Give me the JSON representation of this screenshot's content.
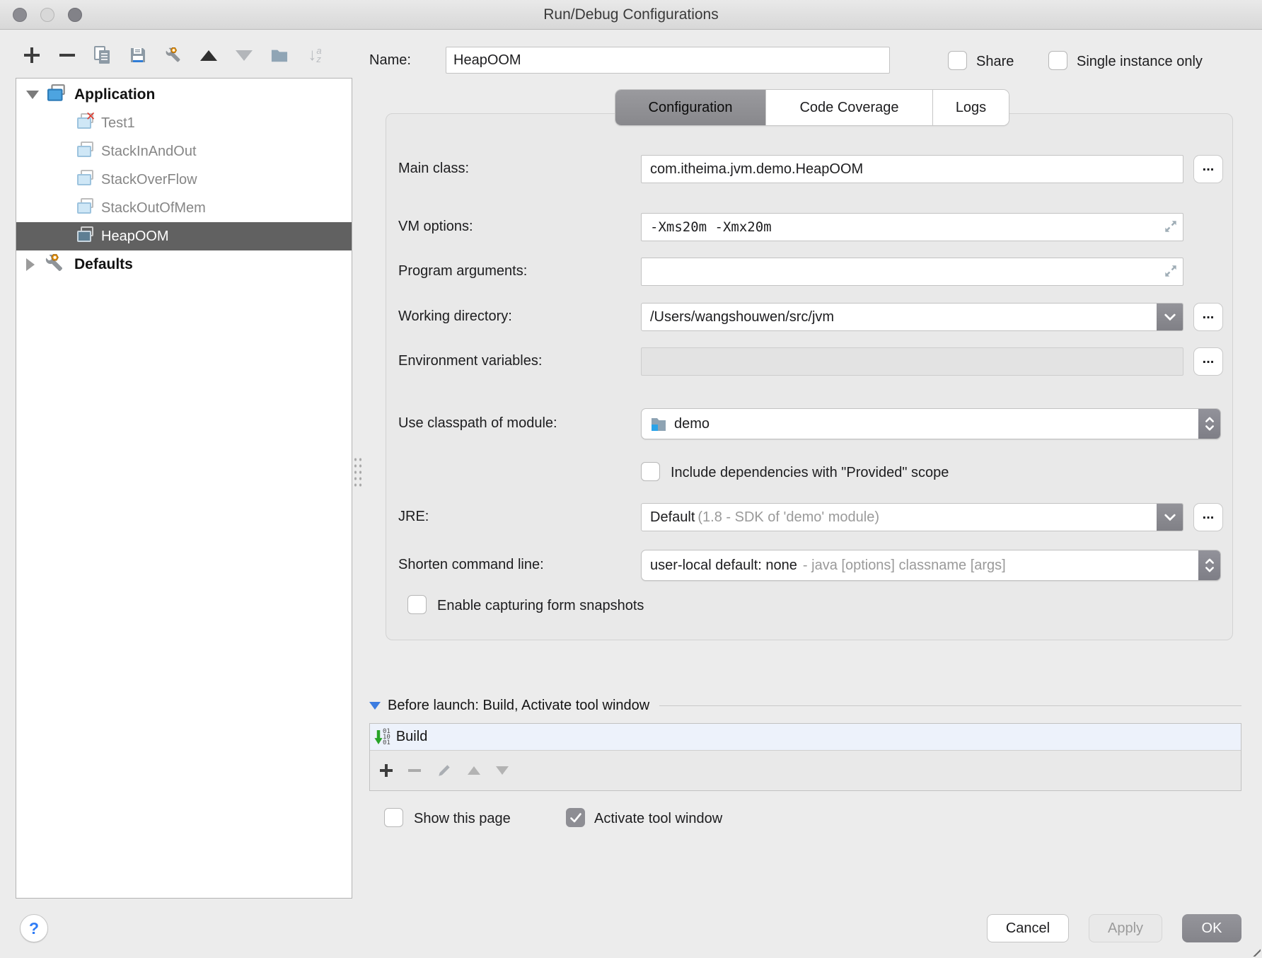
{
  "window": {
    "title": "Run/Debug Configurations"
  },
  "toolbar": {
    "icons": [
      "add",
      "remove",
      "copy",
      "save",
      "edit-defaults",
      "move-up",
      "move-down",
      "folder",
      "sort-alphabetically"
    ]
  },
  "icons": {
    "sort_arrow": "↓",
    "sort_a": "a",
    "sort_z": "z",
    "build_bits": [
      "01",
      "10",
      "01"
    ]
  },
  "tree": {
    "items": [
      {
        "label": "Application",
        "type": "group",
        "expanded": true
      },
      {
        "label": "Test1",
        "type": "config",
        "invalid": true
      },
      {
        "label": "StackInAndOut",
        "type": "config"
      },
      {
        "label": "StackOverFlow",
        "type": "config"
      },
      {
        "label": "StackOutOfMem",
        "type": "config"
      },
      {
        "label": "HeapOOM",
        "type": "config",
        "selected": true
      },
      {
        "label": "Defaults",
        "type": "group",
        "expanded": false
      }
    ]
  },
  "header": {
    "name_label": "Name:",
    "name_value": "HeapOOM",
    "share_label": "Share",
    "single_instance_label": "Single instance only"
  },
  "tabs": {
    "items": [
      {
        "label": "Configuration",
        "active": true
      },
      {
        "label": "Code Coverage"
      },
      {
        "label": "Logs"
      }
    ]
  },
  "form": {
    "browse_label": "...",
    "main_class": {
      "label": "Main class:",
      "value": "com.itheima.jvm.demo.HeapOOM"
    },
    "vm_options": {
      "label": "VM options:",
      "value": "-Xms20m -Xmx20m"
    },
    "program_arguments": {
      "label": "Program arguments:",
      "value": ""
    },
    "working_directory": {
      "label": "Working directory:",
      "value": "/Users/wangshouwen/src/jvm"
    },
    "environment_variables": {
      "label": "Environment variables:",
      "value": ""
    },
    "classpath_module": {
      "label": "Use classpath of module:",
      "value": "demo"
    },
    "provided_scope": {
      "label": "Include dependencies with \"Provided\" scope",
      "checked": false
    },
    "jre": {
      "label": "JRE:",
      "value": "Default",
      "hint": "(1.8 - SDK of 'demo' module)"
    },
    "shorten": {
      "label": "Shorten command line:",
      "value": "user-local default: none",
      "hint": "- java [options] classname [args]"
    },
    "form_snapshots": {
      "label": "Enable capturing form snapshots",
      "checked": false
    }
  },
  "before_launch": {
    "title": "Before launch: Build, Activate tool window",
    "items": [
      {
        "label": "Build"
      }
    ],
    "show_this_page": {
      "label": "Show this page",
      "checked": false
    },
    "activate_tool_window": {
      "label": "Activate tool window",
      "checked": true
    }
  },
  "footer": {
    "help": "?",
    "cancel": "Cancel",
    "apply": "Apply",
    "ok": "OK"
  },
  "colors": {
    "accent_blue": "#3c7ce0",
    "tree_selection": "#616161",
    "build_row_highlight": "#edf2fb",
    "module_icon_blue": "#2ba3e8",
    "build_arrow_green": "#28a428",
    "invalid_red": "#dd3b2f",
    "button_gray": "#8a8a90"
  }
}
